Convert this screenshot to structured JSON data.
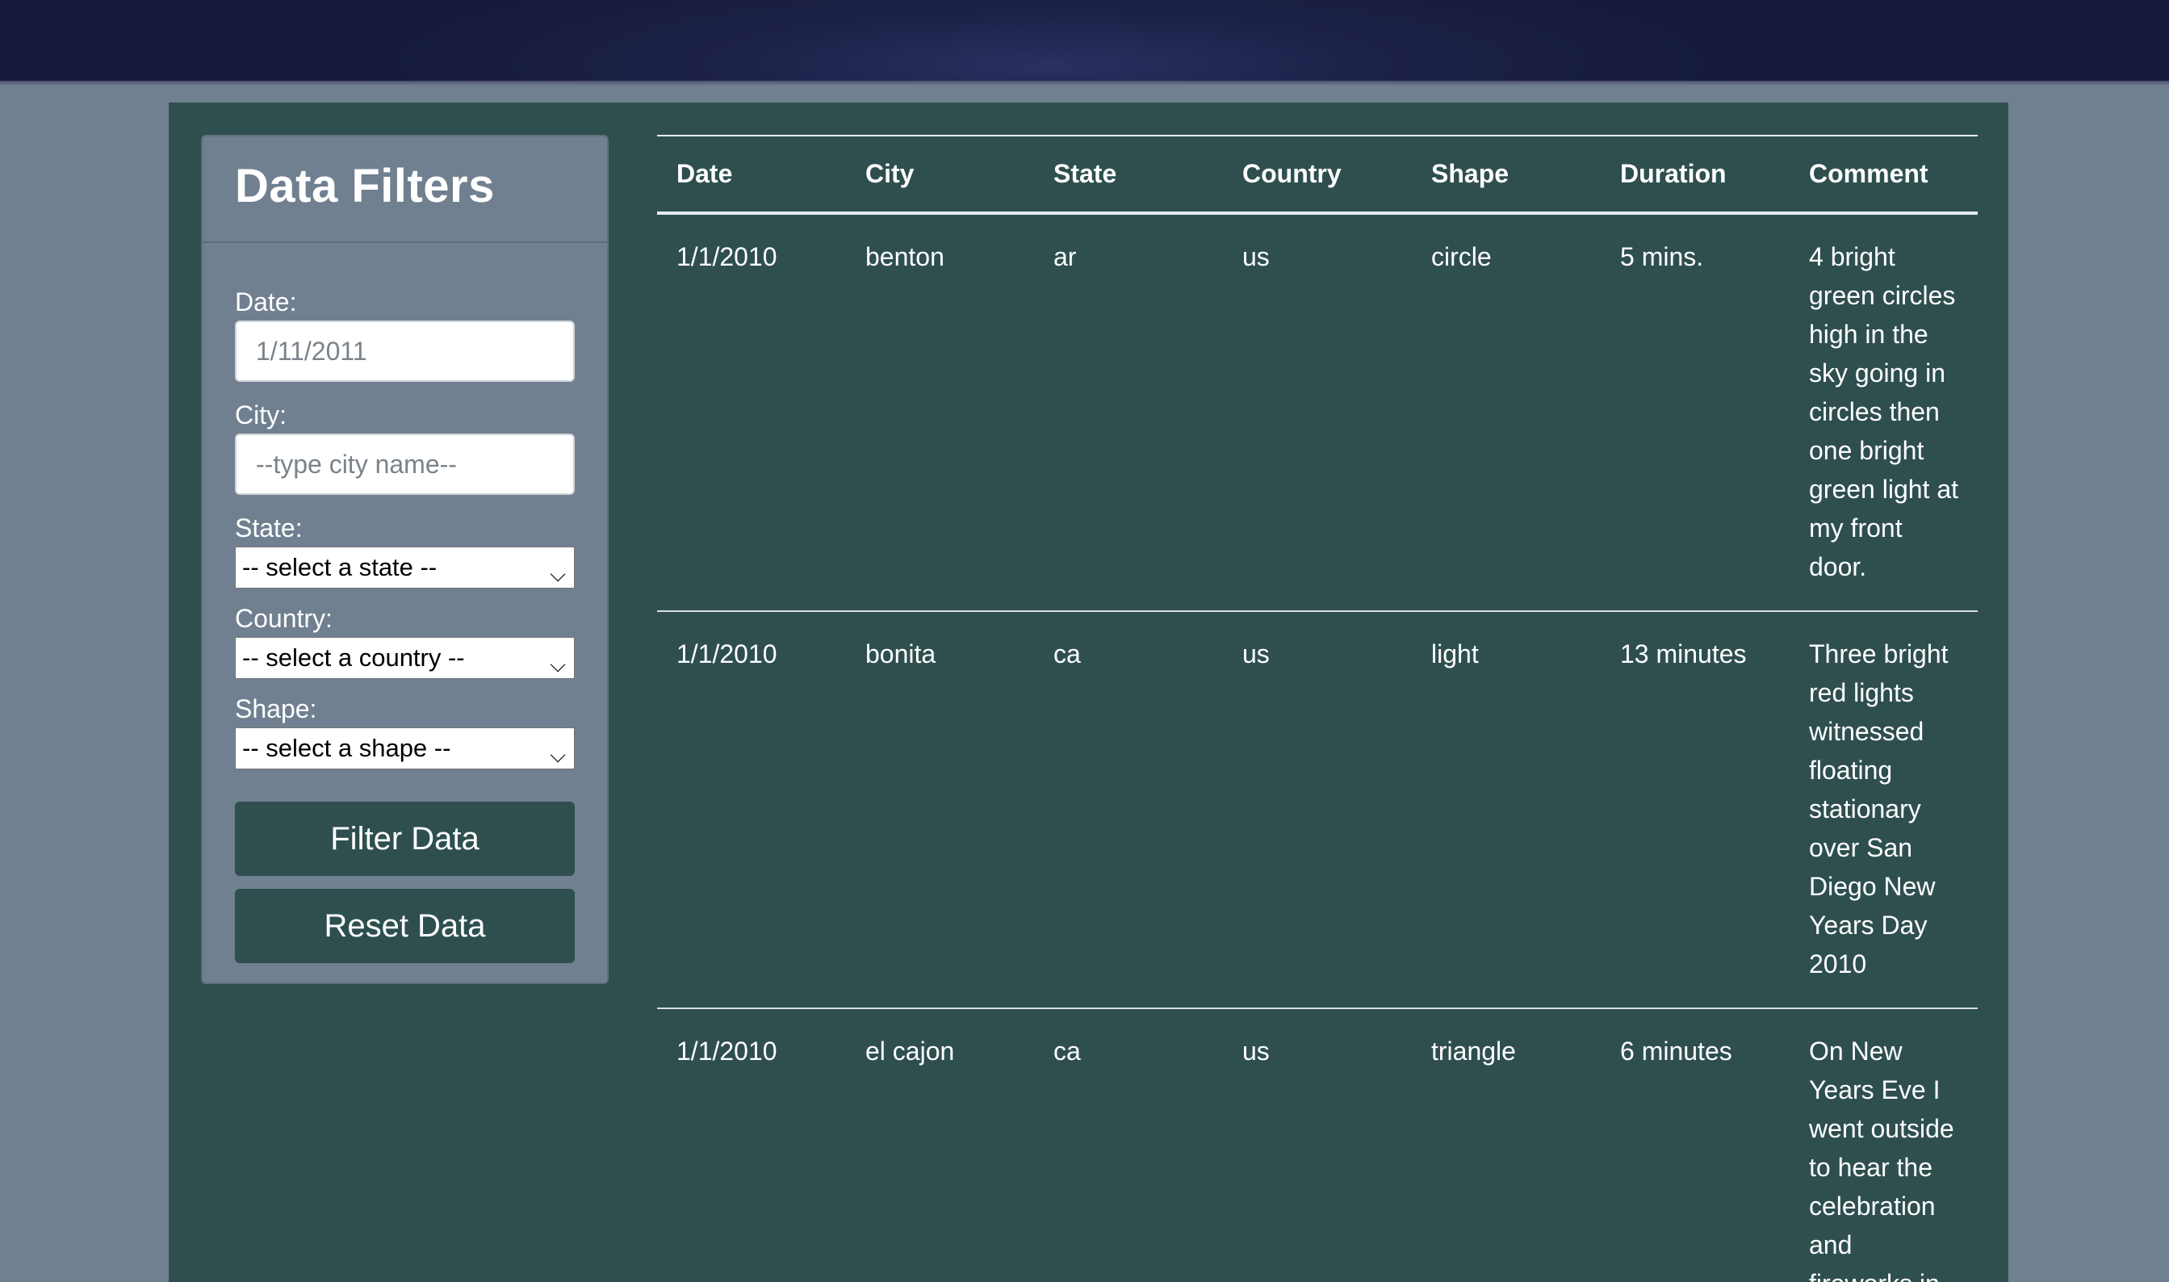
{
  "filters": {
    "title": "Data Filters",
    "date": {
      "label": "Date:",
      "placeholder": "1/11/2011"
    },
    "city": {
      "label": "City:",
      "placeholder": "--type city name--"
    },
    "state": {
      "label": "State:",
      "selected": "-- select a state --"
    },
    "country": {
      "label": "Country:",
      "selected": "-- select a country --"
    },
    "shape": {
      "label": "Shape:",
      "selected": "-- select a shape --"
    },
    "filter_button": "Filter Data",
    "reset_button": "Reset Data"
  },
  "table": {
    "headers": [
      "Date",
      "City",
      "State",
      "Country",
      "Shape",
      "Duration",
      "Comment"
    ],
    "rows": [
      [
        "1/1/2010",
        "benton",
        "ar",
        "us",
        "circle",
        "5 mins.",
        "4 bright green circles high in the sky going in circles then one bright green light at my front door."
      ],
      [
        "1/1/2010",
        "bonita",
        "ca",
        "us",
        "light",
        "13 minutes",
        "Three bright red lights witnessed floating stationary over San Diego New Years Day 2010"
      ],
      [
        "1/1/2010",
        "el cajon",
        "ca",
        "us",
        "triangle",
        "6 minutes",
        "On New Years Eve I went outside to hear the celebration and fireworks in"
      ]
    ]
  },
  "colors": {
    "page_bg": "#708090",
    "content_bg": "#2f4f4f",
    "panel_bg": "#708090",
    "header_bg": "#1c2148",
    "button_bg": "#2f4f4f"
  }
}
